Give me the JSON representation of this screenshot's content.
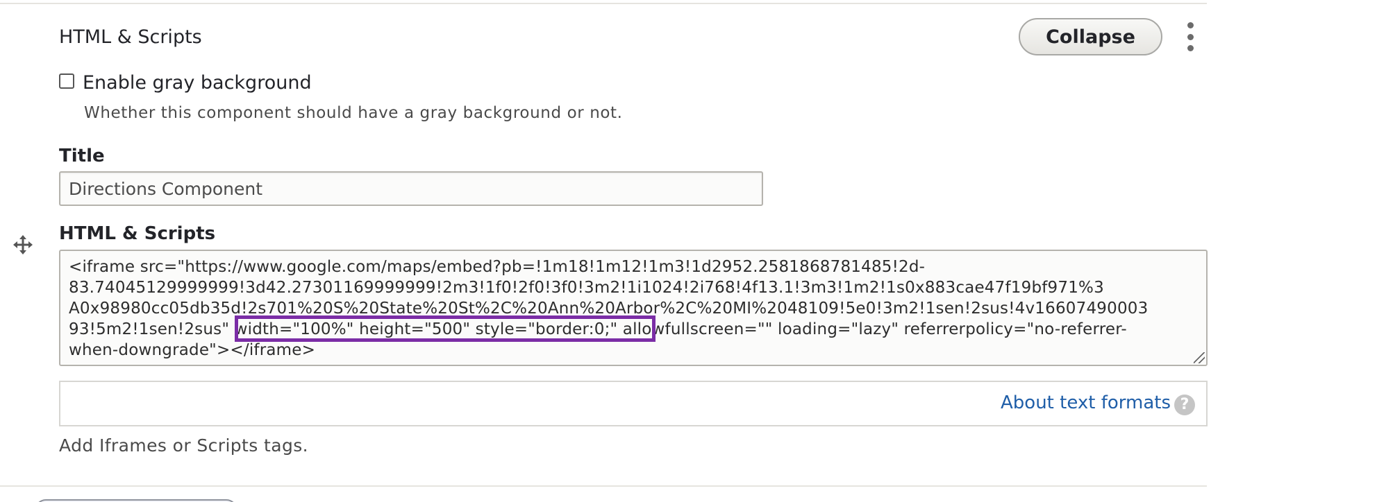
{
  "section": {
    "title": "HTML & Scripts",
    "collapse_label": "Collapse",
    "menu_icon": "kebab-menu-icon"
  },
  "gray_background": {
    "label": "Enable gray background",
    "checked": false,
    "description": "Whether this component should have a gray background or not."
  },
  "title_field": {
    "label": "Title",
    "value": "Directions Component"
  },
  "html_field": {
    "label": "HTML & Scripts",
    "drag_icon": "move-handle-icon",
    "lines": [
      "<iframe src=\"https://www.google.com/maps/embed?pb=!1m18!1m12!1m3!1d2952.2581868781485!2d-",
      "83.74045129999999!3d42.27301169999999!2m3!1f0!2f0!3f0!3m2!1i1024!2i768!4f13.1!3m3!1m2!1s0x883cae47f19bf971%3",
      "A0x98980cc05db35d!2s701%20S%20State%20St%2C%20Ann%20Arbor%2C%20MI%2048109!5e0!3m2!1sen!2sus!4v16607490003",
      "93!5m2!1sen!2sus\" width=\"100%\" height=\"500\" style=\"border:0;\" allowfullscreen=\"\" loading=\"lazy\" referrerpolicy=\"no-referrer-",
      "when-downgrade\"></iframe>"
    ],
    "highlight_color": "#7b2da6"
  },
  "text_formats": {
    "link_label": "About text formats",
    "help_icon": "question-circle-icon",
    "help_glyph": "?"
  },
  "help_text": "Add Iframes or Scripts tags.",
  "colors": {
    "link": "#1f5ea8",
    "highlight": "#7b2da6"
  }
}
